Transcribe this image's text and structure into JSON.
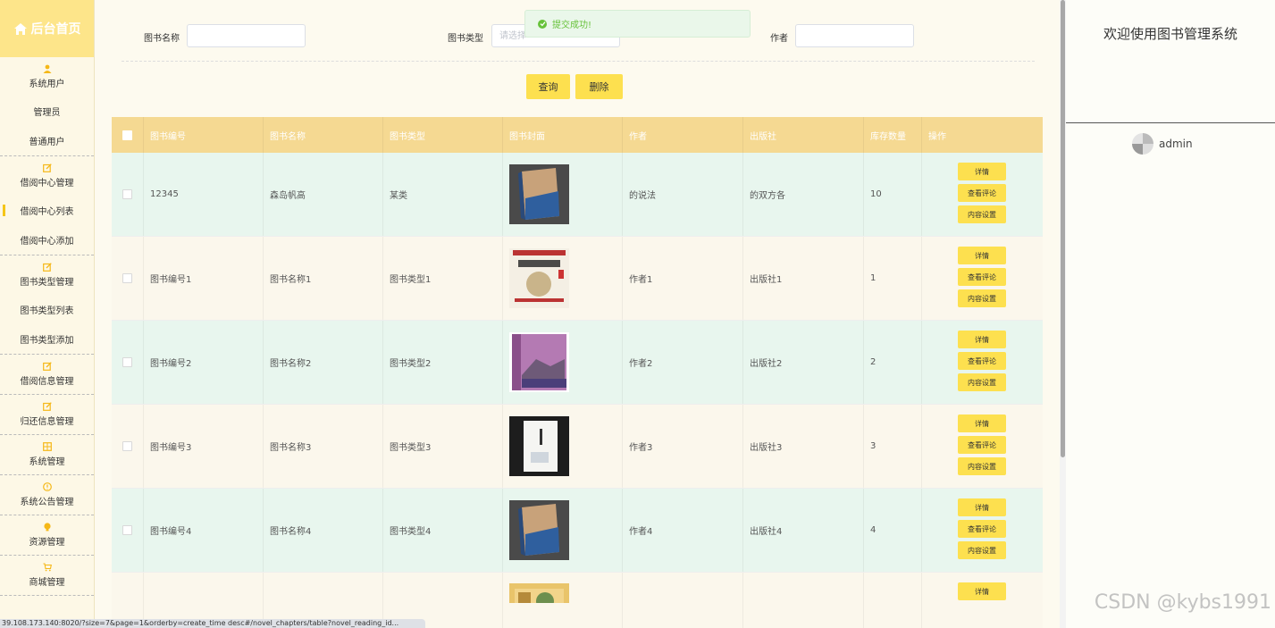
{
  "sidebar": {
    "home": "后台首页",
    "groups": [
      {
        "label": "系统用户",
        "icon": "person-icon",
        "subs": [
          "管理员",
          "普通用户"
        ]
      },
      {
        "label": "借阅中心管理",
        "icon": "edit-icon",
        "subs": [
          "借阅中心列表",
          "借阅中心添加"
        ]
      },
      {
        "label": "图书类型管理",
        "icon": "edit-icon",
        "subs": [
          "图书类型列表",
          "图书类型添加"
        ]
      },
      {
        "label": "借阅信息管理",
        "icon": "edit-icon",
        "subs": []
      },
      {
        "label": "归还信息管理",
        "icon": "edit-icon",
        "subs": []
      },
      {
        "label": "系统管理",
        "icon": "grid-icon",
        "subs": []
      },
      {
        "label": "系统公告管理",
        "icon": "info-icon",
        "subs": []
      },
      {
        "label": "资源管理",
        "icon": "bulb-icon",
        "subs": []
      },
      {
        "label": "商城管理",
        "icon": "cart-icon",
        "subs": []
      }
    ],
    "active_sub": "借阅中心列表"
  },
  "search": {
    "name_label": "图书名称",
    "type_label": "图书类型",
    "type_placeholder": "请选择",
    "author_label": "作者",
    "query_button": "查询",
    "delete_button": "删除"
  },
  "toast": {
    "message": "提交成功!"
  },
  "table": {
    "headers": [
      "图书编号",
      "图书名称",
      "图书类型",
      "图书封面",
      "作者",
      "出版社",
      "库存数量",
      "操作"
    ],
    "ops": [
      "详情",
      "查看评论",
      "内容设置"
    ],
    "rows": [
      {
        "id": "12345",
        "name": "森岛帆高",
        "type": "某类",
        "cover": "blue-book",
        "author": "的说法",
        "publisher": "的双方各",
        "stock": "10"
      },
      {
        "id": "图书编号1",
        "name": "图书名称1",
        "type": "图书类型1",
        "cover": "sanguo-book",
        "author": "作者1",
        "publisher": "出版社1",
        "stock": "1"
      },
      {
        "id": "图书编号2",
        "name": "图书名称2",
        "type": "图书类型2",
        "cover": "purple-book",
        "author": "作者2",
        "publisher": "出版社2",
        "stock": "2"
      },
      {
        "id": "图书编号3",
        "name": "图书名称3",
        "type": "图书类型3",
        "cover": "white-book",
        "author": "作者3",
        "publisher": "出版社3",
        "stock": "3"
      },
      {
        "id": "图书编号4",
        "name": "图书名称4",
        "type": "图书类型4",
        "cover": "blue-book",
        "author": "作者4",
        "publisher": "出版社4",
        "stock": "4"
      },
      {
        "id": "",
        "name": "",
        "type": "",
        "cover": "yellow-book",
        "author": "",
        "publisher": "",
        "stock": ""
      }
    ]
  },
  "right_panel": {
    "welcome": "欢迎使用图书管理系统",
    "username": "admin"
  },
  "watermark": "CSDN @kybs1991",
  "status_url": "39.108.173.140:8020/?size=7&page=1&orderby=create_time desc#/novel_chapters/table?novel_reading_id..."
}
